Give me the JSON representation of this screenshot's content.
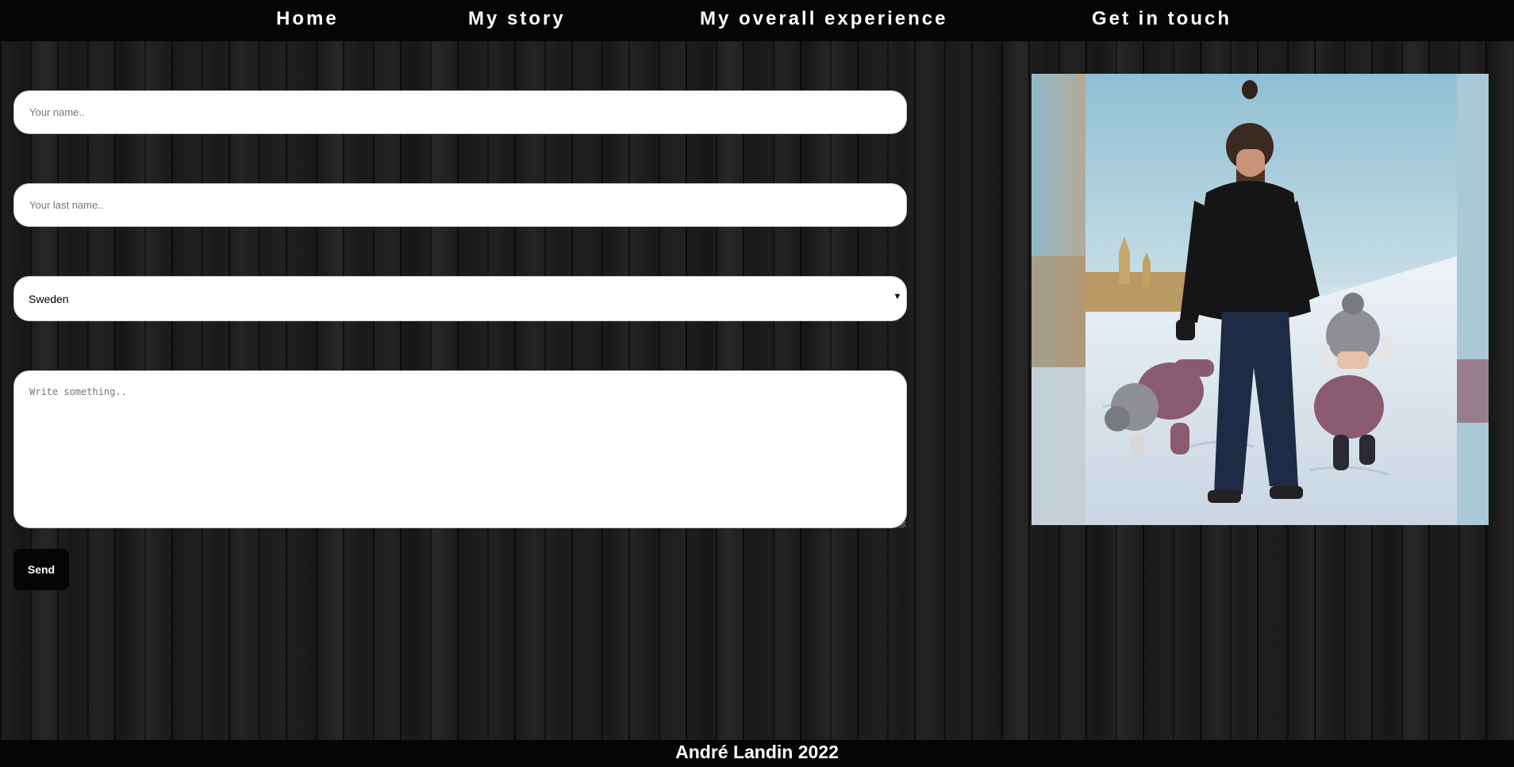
{
  "nav": {
    "items": [
      {
        "label": "Home"
      },
      {
        "label": "My story"
      },
      {
        "label": "My overall experience"
      },
      {
        "label": "Get in touch"
      }
    ]
  },
  "form": {
    "first_name": {
      "placeholder": "Your name..",
      "value": ""
    },
    "last_name": {
      "placeholder": "Your last name..",
      "value": ""
    },
    "country": {
      "selected": "Sweden"
    },
    "message": {
      "placeholder": "Write something.."
    },
    "send_label": "Send"
  },
  "photo": {
    "icon": "photo-family-in-snow"
  },
  "footer": {
    "text": "André Landin 2022"
  },
  "colors": {
    "nav_bg": "#050505",
    "field_bg": "#ffffff",
    "button_bg": "#050505"
  }
}
